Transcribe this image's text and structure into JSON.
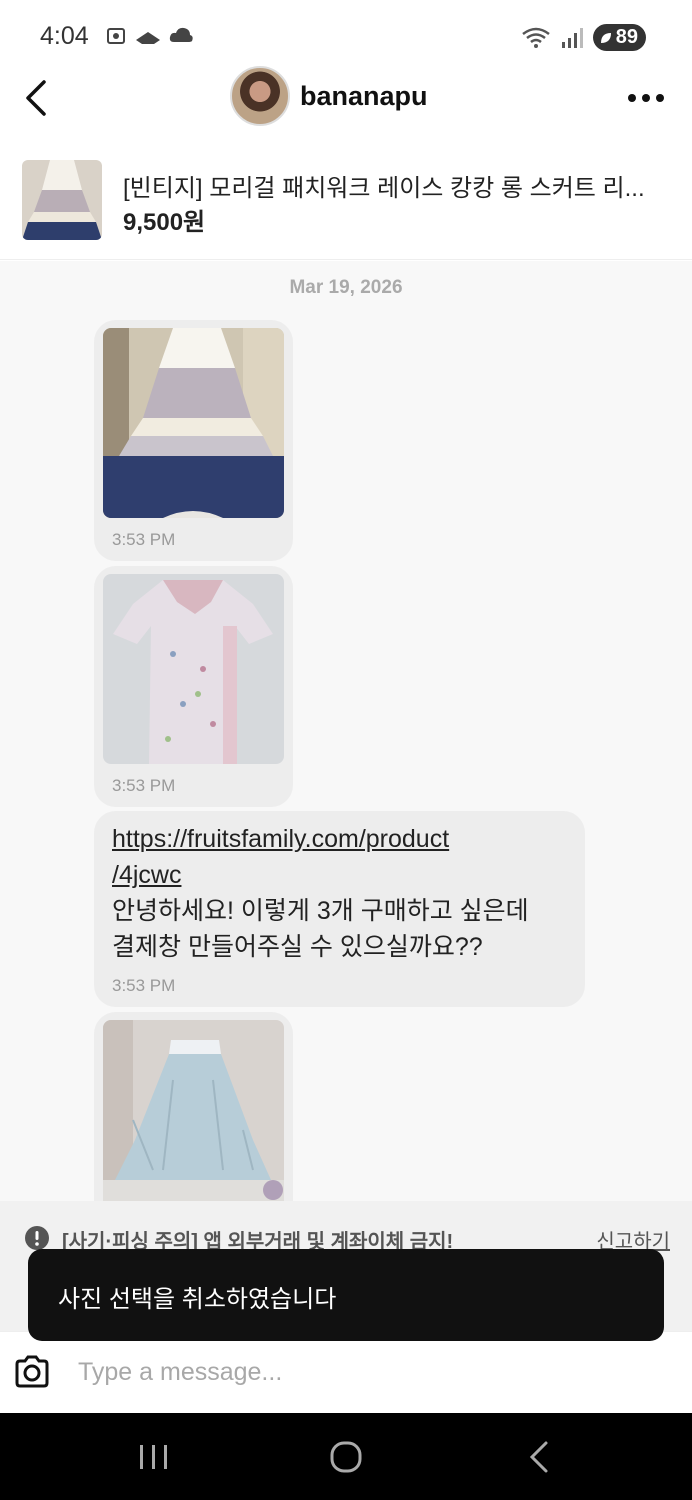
{
  "status_bar": {
    "time": "4:04",
    "battery": "89"
  },
  "chat_header": {
    "username": "bananapu"
  },
  "product": {
    "title": "[빈티지] 모리걸 패치워크 레이스 캉캉 롱 스커트 리...",
    "price": "9,500원"
  },
  "chat": {
    "date": "Mar 19, 2026",
    "messages": [
      {
        "type": "image",
        "time": "3:53 PM"
      },
      {
        "type": "image",
        "time": "3:53 PM"
      },
      {
        "type": "text",
        "link_line1": "https://fruitsfamily.com/product",
        "link_line2": "/4jcwc",
        "line1": "안녕하세요! 이렇게 3개 구매하고 싶은데",
        "line2": "결제창 만들어주실 수 있으실까요??",
        "time": "3:53 PM"
      },
      {
        "type": "image"
      }
    ]
  },
  "warning": {
    "text": "[사기·피싱 주의] 앱 외부거래 및 계좌이체 금지!",
    "report": "신고하기"
  },
  "toast": {
    "text": "사진 선택을 취소하였습니다"
  },
  "composer": {
    "placeholder": "Type a message..."
  },
  "colors": {
    "bubble": "#ededed",
    "toast": "#111111",
    "nav": "#000000"
  }
}
